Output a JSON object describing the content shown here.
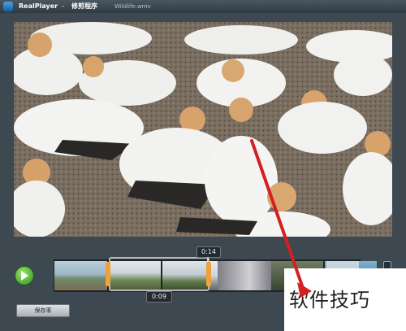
{
  "window": {
    "app_name": "RealPlayer",
    "separator": "-",
    "doc_title": "修剪程序",
    "file_name": "Wildlife.wmv",
    "icon": "realplayer-logo-icon"
  },
  "video": {
    "content": "gannets-colony-frame",
    "colors": {
      "bird_white": "#f2f2f0",
      "bird_head": "#d8a36a",
      "ground": "#6f6458"
    }
  },
  "player": {
    "play_icon": "play-icon",
    "current_time": "0:14",
    "selection_time": "0:09",
    "save_label": "保存率",
    "accent": "#f0a23a"
  },
  "filmstrip": {
    "thumbs": [
      "beach-scene",
      "hill-scene",
      "hill-scene-2",
      "rock-scene",
      "gull-flock",
      "trees",
      "sea-scene",
      "sky-scene"
    ]
  },
  "watermark": {
    "text": "软件技巧"
  },
  "annotation": {
    "arrow_color": "#d42020"
  }
}
